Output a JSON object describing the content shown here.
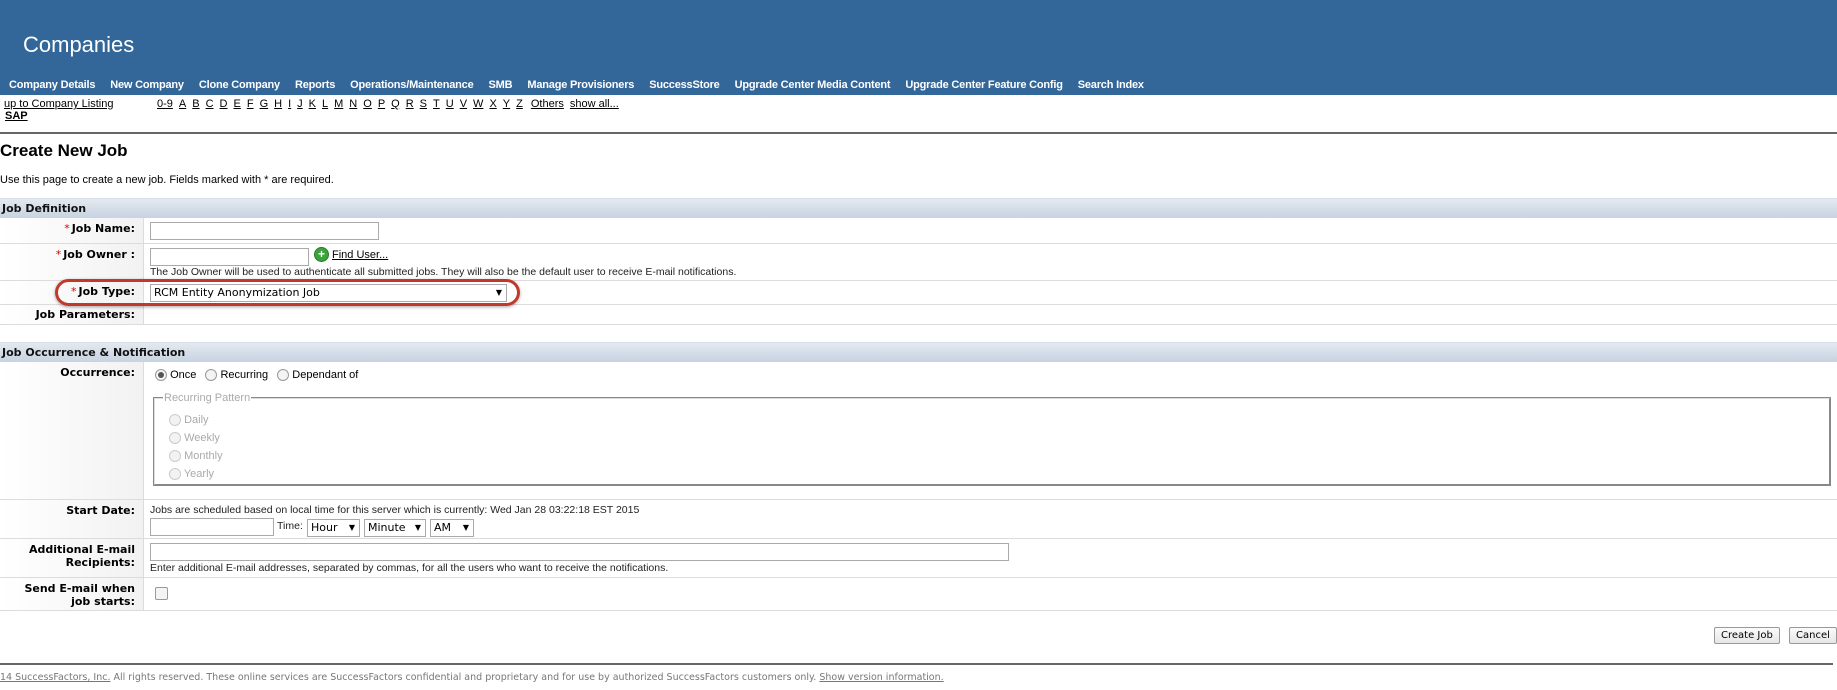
{
  "header": {
    "title": "Companies",
    "nav": [
      "Company Details",
      "New Company",
      "Clone Company",
      "Reports",
      "Operations/Maintenance",
      "SMB",
      "Manage Provisioners",
      "SuccessStore",
      "Upgrade Center Media Content",
      "Upgrade Center Feature Config",
      "Search Index"
    ]
  },
  "subnav": {
    "back_link": "up to Company Listing",
    "company": "SAP",
    "alpha": [
      "0-9",
      "A",
      "B",
      "C",
      "D",
      "E",
      "F",
      "G",
      "H",
      "I",
      "J",
      "K",
      "L",
      "M",
      "N",
      "O",
      "P",
      "Q",
      "R",
      "S",
      "T",
      "U",
      "V",
      "W",
      "X",
      "Y",
      "Z",
      "Others",
      "show all..."
    ]
  },
  "page": {
    "title": "Create New Job",
    "description": "Use this page to create a new job. Fields marked with * are required."
  },
  "job_definition": {
    "section_title": "Job Definition",
    "required_mark": "*",
    "job_name": {
      "label": "Job Name:",
      "value": ""
    },
    "job_owner": {
      "label": "Job Owner :",
      "value": "",
      "find_user": "Find User...",
      "hint": "The Job Owner will be used to authenticate all submitted jobs. They will also be the default user to receive E-mail notifications."
    },
    "job_type": {
      "label": "Job Type:",
      "selected": "RCM Entity Anonymization Job"
    },
    "job_parameters": {
      "label": "Job Parameters:"
    }
  },
  "occurrence_section": {
    "section_title": "Job Occurrence & Notification",
    "occurrence": {
      "label": "Occurrence:",
      "options": [
        "Once",
        "Recurring",
        "Dependant of"
      ],
      "selected": "Once"
    },
    "recurring_pattern": {
      "legend": "Recurring Pattern",
      "options": [
        "Daily",
        "Weekly",
        "Monthly",
        "Yearly"
      ]
    },
    "start_date": {
      "label": "Start Date:",
      "server_time_text": "Jobs are scheduled based on local time for this server which is currently: Wed Jan 28 03:22:18 EST 2015",
      "date_value": "",
      "time_label": "Time:",
      "hour": "Hour",
      "minute": "Minute",
      "ampm": "AM"
    },
    "additional_email": {
      "label_line1": "Additional E-mail",
      "label_line2": "Recipients:",
      "value": "",
      "hint": "Enter additional E-mail addresses, separated by commas, for all the users who want to receive the notifications."
    },
    "send_email": {
      "label_line1": "Send E-mail when",
      "label_line2": "job starts:",
      "checked": false
    }
  },
  "actions": {
    "create": "Create Job",
    "cancel": "Cancel"
  },
  "footer": {
    "copyright_link": "14 SuccessFactors, Inc.",
    "text": " All rights reserved. These online services are SuccessFactors confidential and proprietary and for use by authorized SuccessFactors customers only. ",
    "version_link": "Show version information."
  },
  "colors": {
    "header_bg": "#336699",
    "highlight": "#c0392b",
    "required": "#cc0000"
  }
}
